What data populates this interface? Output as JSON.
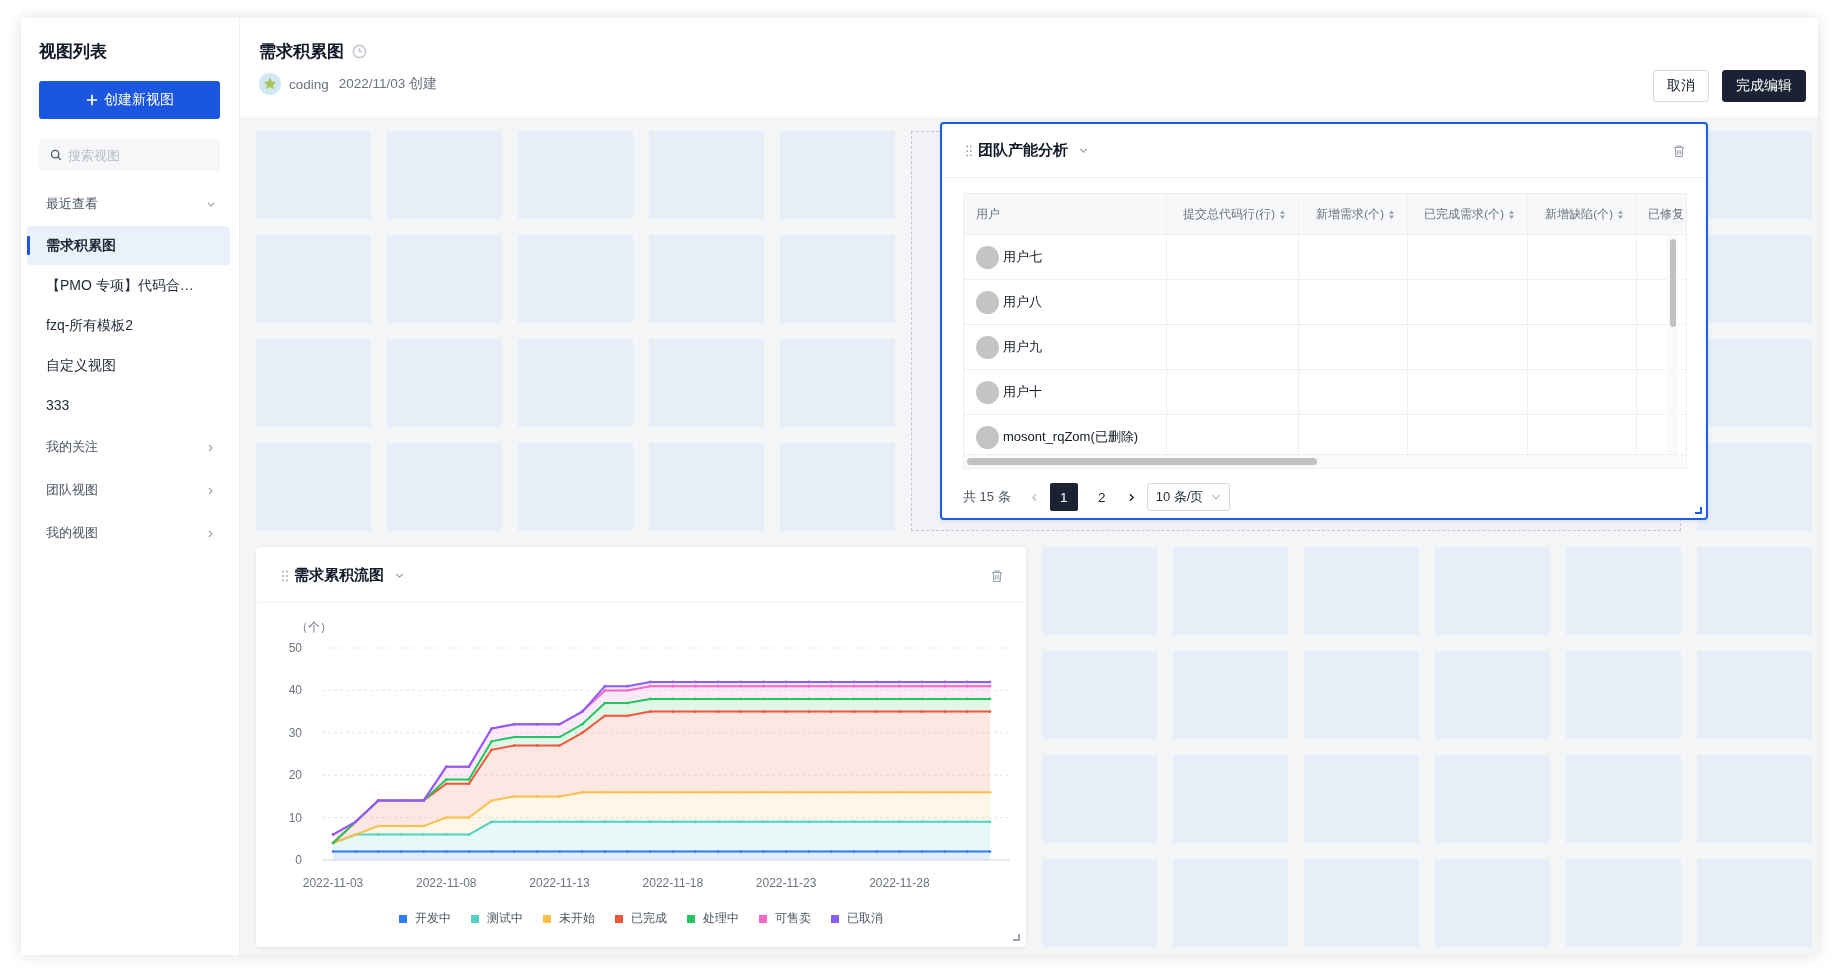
{
  "sidebar": {
    "title": "视图列表",
    "create_button": "创建新视图",
    "search": {
      "placeholder": "搜索视图"
    },
    "sections": [
      {
        "label": "最近查看",
        "expanded": true,
        "items": [
          {
            "label": "需求积累图",
            "selected": true
          },
          {
            "label": "【PMO 专项】代码合…",
            "selected": false
          },
          {
            "label": "fzq-所有模板2",
            "selected": false
          },
          {
            "label": "自定义视图",
            "selected": false
          },
          {
            "label": "333",
            "selected": false
          }
        ]
      },
      {
        "label": "我的关注",
        "expanded": false
      },
      {
        "label": "团队视图",
        "expanded": false
      },
      {
        "label": "我的视图",
        "expanded": false
      }
    ]
  },
  "header": {
    "title": "需求积累图",
    "author": "coding",
    "created": "2022/11/03 创建",
    "buttons": [
      {
        "label": "取消",
        "kind": "secondary"
      },
      {
        "label": "完成编辑",
        "kind": "primary"
      }
    ]
  },
  "table_widget": {
    "title": "团队产能分析",
    "selected": true,
    "columns": [
      {
        "label": "用户",
        "sortable": false
      },
      {
        "label": "提交总代码行(行)",
        "sortable": true
      },
      {
        "label": "新增需求(个)",
        "sortable": true
      },
      {
        "label": "已完成需求(个)",
        "sortable": true
      },
      {
        "label": "新增缺陷(个)",
        "sortable": true
      },
      {
        "label": "已修复",
        "sortable": false
      }
    ],
    "rows": [
      {
        "user": "用户七"
      },
      {
        "user": "用户八"
      },
      {
        "user": "用户九"
      },
      {
        "user": "用户十"
      },
      {
        "user": "mosont_rqZom(已删除)"
      }
    ],
    "pagination": {
      "total": "共 15 条",
      "pages": [
        {
          "label": "1",
          "selected": true
        },
        {
          "label": "2",
          "selected": false
        }
      ],
      "page_size": "10 条/页"
    }
  },
  "chart_widget": {
    "title": "需求累积流图",
    "selected": false,
    "chart_data": {
      "type": "area",
      "stacked": true,
      "ylabel": "（个）",
      "categories": [
        "2022-11-03",
        null,
        null,
        null,
        null,
        "2022-11-08",
        null,
        null,
        null,
        null,
        "2022-11-13",
        null,
        null,
        null,
        null,
        "2022-11-18",
        null,
        null,
        null,
        null,
        "2022-11-23",
        null,
        null,
        null,
        null,
        "2022-11-28",
        null,
        null,
        null,
        null
      ],
      "grid": true,
      "legend": true,
      "ylim": [
        0,
        50
      ],
      "yticks": [
        0,
        10,
        20,
        30,
        40,
        50
      ],
      "series": [
        {
          "name": "开发中",
          "color": "#2f7cf6",
          "values": [
            2,
            2,
            2,
            2,
            2,
            2,
            2,
            2,
            2,
            2,
            2,
            2,
            2,
            2,
            2,
            2,
            2,
            2,
            2,
            2,
            2,
            2,
            2,
            2,
            2,
            2,
            2,
            2,
            2,
            2
          ]
        },
        {
          "name": "测试中",
          "color": "#4fd1c5",
          "values": [
            2,
            4,
            4,
            4,
            4,
            4,
            4,
            7,
            7,
            7,
            7,
            7,
            7,
            7,
            7,
            7,
            7,
            7,
            7,
            7,
            7,
            7,
            7,
            7,
            7,
            7,
            7,
            7,
            7,
            7
          ]
        },
        {
          "name": "未开始",
          "color": "#fbbf4b",
          "values": [
            0,
            0,
            2,
            2,
            2,
            4,
            4,
            5,
            6,
            6,
            6,
            7,
            7,
            7,
            7,
            7,
            7,
            7,
            7,
            7,
            7,
            7,
            7,
            7,
            7,
            7,
            7,
            7,
            7,
            7
          ]
        },
        {
          "name": "已完成",
          "color": "#f4553b",
          "values": [
            0,
            3,
            6,
            6,
            6,
            8,
            8,
            12,
            12,
            12,
            12,
            14,
            18,
            18,
            19,
            19,
            19,
            19,
            19,
            19,
            19,
            19,
            19,
            19,
            19,
            19,
            19,
            19,
            19,
            19
          ]
        },
        {
          "name": "处理中",
          "color": "#22c55e",
          "values": [
            0,
            0,
            0,
            0,
            0,
            1,
            1,
            2,
            2,
            2,
            2,
            2,
            3,
            3,
            3,
            3,
            3,
            3,
            3,
            3,
            3,
            3,
            3,
            3,
            3,
            3,
            3,
            3,
            3,
            3
          ]
        },
        {
          "name": "可售卖",
          "color": "#f766c8",
          "values": [
            2,
            0,
            0,
            0,
            0,
            3,
            3,
            3,
            3,
            3,
            3,
            3,
            3,
            3,
            3,
            3,
            3,
            3,
            3,
            3,
            3,
            3,
            3,
            3,
            3,
            3,
            3,
            3,
            3,
            3
          ]
        },
        {
          "name": "已取消",
          "color": "#8b5cf6",
          "values": [
            0,
            0,
            0,
            0,
            0,
            0,
            0,
            0,
            0,
            0,
            0,
            0,
            1,
            1,
            1,
            1,
            1,
            1,
            1,
            1,
            1,
            1,
            1,
            1,
            1,
            1,
            1,
            1,
            1,
            1
          ]
        }
      ]
    }
  }
}
